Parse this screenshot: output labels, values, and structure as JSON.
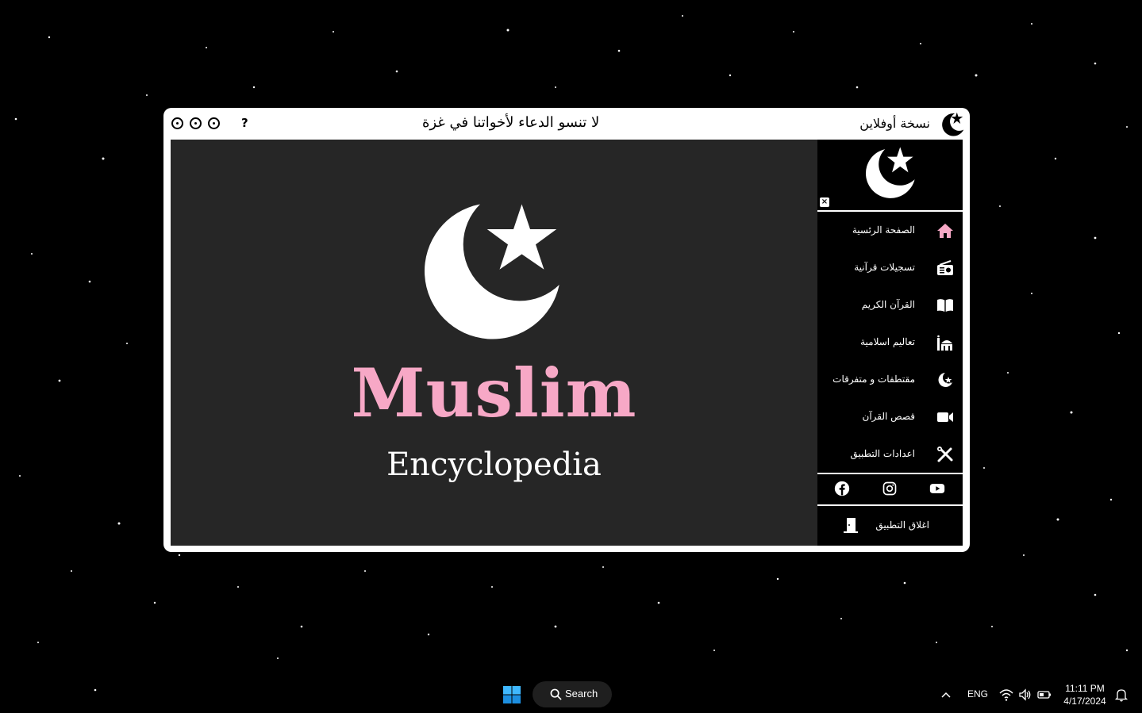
{
  "titlebar": {
    "help_label": "?",
    "message": "لا تنسو الدعاء لأخواتنا في غزة",
    "app_title": "نسخة أوفلاين"
  },
  "hero": {
    "title": "Muslim",
    "subtitle": "Encyclopedia"
  },
  "sidebar": {
    "close_label": "×",
    "items": [
      {
        "label": "الصفحة الرئسية",
        "icon": "home-icon"
      },
      {
        "label": "تسجيلات قرآنية",
        "icon": "radio-icon"
      },
      {
        "label": "القرآن الكريم",
        "icon": "book-icon"
      },
      {
        "label": "تعاليم اسلامية",
        "icon": "mosque-icon"
      },
      {
        "label": "مقتطفات و متفرقات",
        "icon": "crescent-star-icon"
      },
      {
        "label": "قصص القرآن",
        "icon": "video-icon"
      },
      {
        "label": "اعدادات التطبيق",
        "icon": "tools-icon"
      }
    ],
    "socials": [
      "facebook-icon",
      "instagram-icon",
      "youtube-icon"
    ],
    "exit_label": "اغلاق التطبيق"
  },
  "taskbar": {
    "search_label": "Search",
    "language": "ENG",
    "time": "11:11 PM",
    "date": "4/17/2024"
  },
  "colors": {
    "accent_pink": "#f7a8c6",
    "content_bg": "#262626",
    "sidebar_bg": "#000000"
  }
}
